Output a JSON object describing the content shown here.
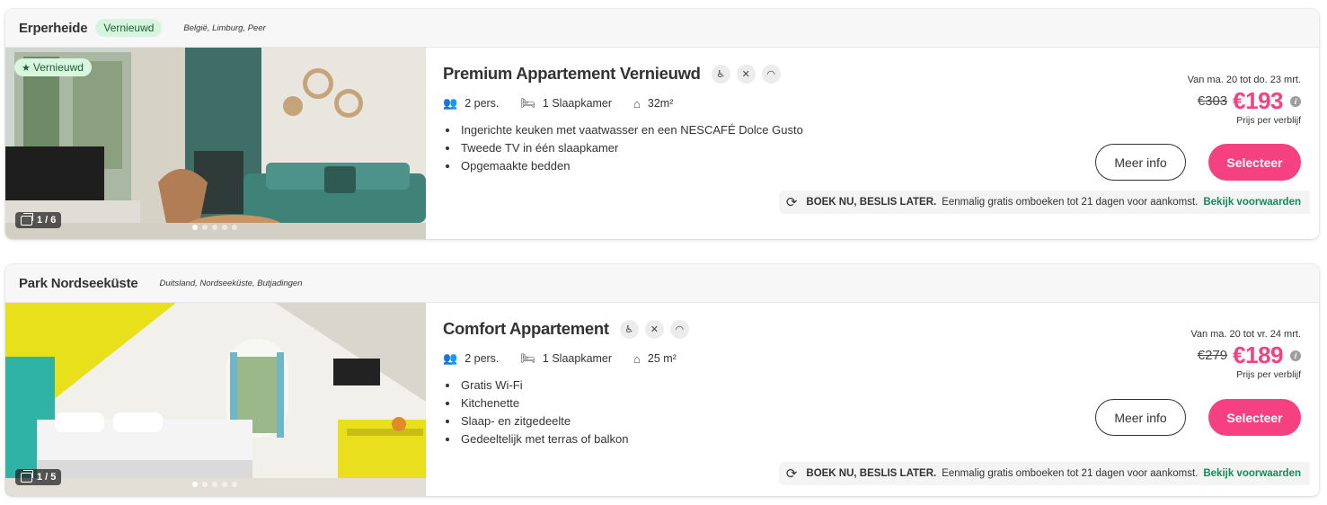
{
  "listings": [
    {
      "park_name": "Erperheide",
      "head_badge": "Vernieuwd",
      "location": "België, Limburg, Peer",
      "photo_badge": "Vernieuwd",
      "photo_count": "1 / 6",
      "title": "Premium Appartement Vernieuwd",
      "amenity_icons": [
        "no-wheelchair-icon",
        "no-pets-icon",
        "wifi-icon"
      ],
      "persons": "2 pers.",
      "bedrooms": "1 Slaapkamer",
      "area": "32m²",
      "features": [
        "Ingerichte keuken met vaatwasser en een NESCAFÉ Dolce Gusto",
        "Tweede TV in één slaapkamer",
        "Opgemaakte bedden"
      ],
      "date_range": "Van ma. 20 tot do. 23 mrt.",
      "old_price": "€303",
      "new_price": "€193",
      "price_note": "Prijs per verblijf",
      "more_info_label": "Meer info",
      "select_label": "Selecteer",
      "book_bold": "BOEK NU, BESLIS LATER.",
      "book_text": "Eenmalig gratis omboeken tot 21 dagen voor aankomst.",
      "book_link": "Bekijk voorwaarden"
    },
    {
      "park_name": "Park Nordseeküste",
      "location": "Duitsland, Nordseeküste, Butjadingen",
      "photo_count": "1 / 5",
      "title": "Comfort Appartement",
      "amenity_icons": [
        "no-wheelchair-icon",
        "no-pets-icon",
        "wifi-icon"
      ],
      "persons": "2 pers.",
      "bedrooms": "1 Slaapkamer",
      "area": "25 m²",
      "features": [
        "Gratis Wi-Fi",
        "Kitchenette",
        "Slaap- en zitgedeelte",
        "Gedeeltelijk met terras of balkon"
      ],
      "date_range": "Van ma. 20 tot vr. 24 mrt.",
      "old_price": "€279",
      "new_price": "€189",
      "price_note": "Prijs per verblijf",
      "more_info_label": "Meer info",
      "select_label": "Selecteer",
      "book_bold": "BOEK NU, BESLIS LATER.",
      "book_text": "Eenmalig gratis omboeken tot 21 dagen voor aankomst.",
      "book_link": "Bekijk voorwaarden"
    }
  ],
  "colors": {
    "accent_pink": "#f5417f",
    "link_green": "#138a5c",
    "badge_green_bg": "#d7f5de"
  }
}
